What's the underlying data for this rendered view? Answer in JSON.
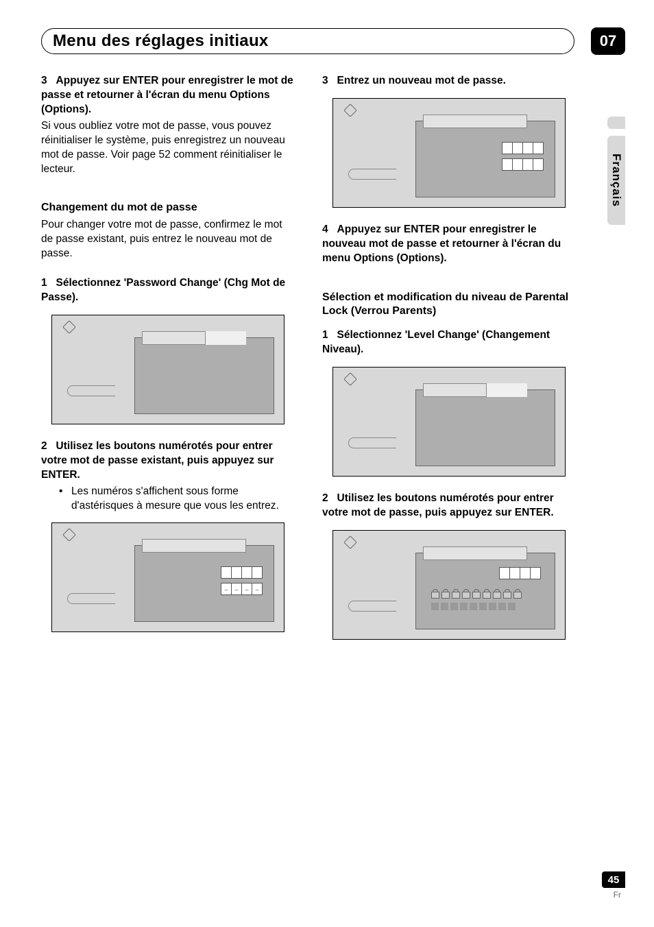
{
  "header": {
    "title": "Menu des réglages initiaux",
    "chapter": "07"
  },
  "side_label": "Français",
  "left_col": {
    "step3": {
      "num": "3",
      "bold": "Appuyez sur ENTER pour enregistrer le mot de passe et retourner à l'écran du menu Options (Options).",
      "body1": "Si vous oubliez votre mot de passe, vous pouvez réinitialiser le système, puis enregistrez un nouveau mot de passe. Voir ",
      "page_ref": "page 52",
      "body2": " comment réinitialiser le lecteur."
    },
    "heading1": "Changement du mot de passe",
    "body_change": "Pour changer votre mot de passe, confirmez le mot de passe existant, puis entrez le nouveau mot de passe.",
    "step1": {
      "num": "1",
      "bold": "Sélectionnez 'Password Change' (Chg Mot de Passe)."
    },
    "step2": {
      "num": "2",
      "bold": "Utilisez les boutons numérotés pour entrer votre mot de passe existant, puis appuyez sur ENTER.",
      "bullet": "Les numéros s'affichent sous forme d'astérisques à mesure que vous les entrez."
    }
  },
  "right_col": {
    "step3": {
      "num": "3",
      "bold": "Entrez un nouveau mot de passe."
    },
    "step4": {
      "num": "4",
      "bold": "Appuyez sur ENTER pour enregistrer le nouveau mot de passe et retourner à l'écran du menu Options (Options)."
    },
    "heading2": "Sélection et modification du niveau de Parental Lock (Verrou Parents)",
    "step1": {
      "num": "1",
      "bold": "Sélectionnez 'Level Change' (Changement Niveau)."
    },
    "step2": {
      "num": "2",
      "bold": "Utilisez les boutons numérotés pour entrer votre mot de passe, puis appuyez sur ENTER."
    }
  },
  "footer": {
    "page": "45",
    "lang": "Fr"
  }
}
